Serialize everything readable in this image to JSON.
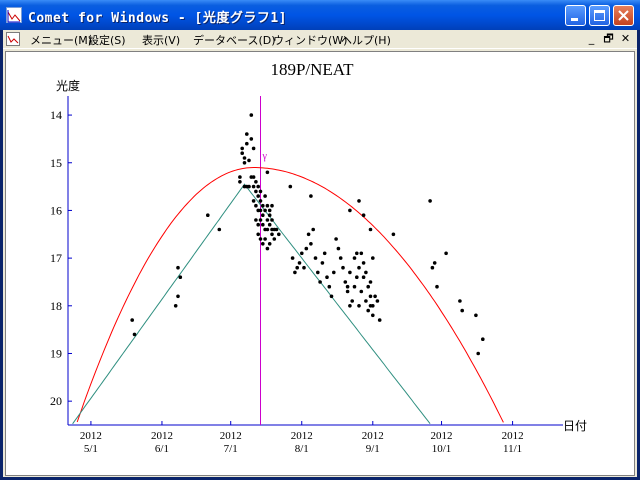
{
  "window": {
    "title": "Comet for Windows - [光度グラフ1]"
  },
  "menu": {
    "items": [
      "メニュー(M)",
      "設定(S)",
      "表示(V)",
      "データベース(D)",
      "ウィンドウ(W)",
      "ヘルプ(H)"
    ]
  },
  "mdi_controls": [
    "_",
    "🗗",
    "✕"
  ],
  "chart_data": {
    "type": "scatter",
    "title": "189P/NEAT",
    "ylabel": "光度",
    "xlabel": "日付",
    "x_ticks": [
      {
        "year": "2012",
        "label": "5/1"
      },
      {
        "year": "2012",
        "label": "6/1"
      },
      {
        "year": "2012",
        "label": "7/1"
      },
      {
        "year": "2012",
        "label": "8/1"
      },
      {
        "year": "2012",
        "label": "9/1"
      },
      {
        "year": "2012",
        "label": "10/1"
      },
      {
        "year": "2012",
        "label": "11/1"
      }
    ],
    "y_ticks": [
      "14",
      "15",
      "16",
      "17",
      "18",
      "19",
      "20"
    ],
    "ylim": [
      13.6,
      20.5
    ],
    "y_inverted": true,
    "xlim_days_from_may1": [
      -10,
      206
    ],
    "colors": {
      "points": "#000000",
      "red_curve": "#FF0000",
      "teal_curve": "#2F8F80",
      "marker_line": "#CC00CC",
      "axis": "#0000CC"
    },
    "marker_line": {
      "x": "2012-07-14",
      "label": "γ"
    },
    "red_curve": {
      "peak_x": "2012-07-11",
      "peak_mag": 15.1
    },
    "teal_curve": {
      "peak_x": "2012-07-07",
      "peak_mag": 15.45
    },
    "points": [
      [
        "05-19",
        18.3
      ],
      [
        "05-20",
        18.6
      ],
      [
        "06-08",
        17.2
      ],
      [
        "06-09",
        17.4
      ],
      [
        "06-07",
        18.0
      ],
      [
        "06-08",
        17.8
      ],
      [
        "06-21",
        16.1
      ],
      [
        "06-26",
        16.4
      ],
      [
        "07-05",
        15.3
      ],
      [
        "07-05",
        15.4
      ],
      [
        "07-06",
        14.7
      ],
      [
        "07-06",
        14.8
      ],
      [
        "07-07",
        14.9
      ],
      [
        "07-07",
        15.0
      ],
      [
        "07-08",
        14.4
      ],
      [
        "07-08",
        14.6
      ],
      [
        "07-09",
        14.95
      ],
      [
        "07-10",
        14.0
      ],
      [
        "07-10",
        14.5
      ],
      [
        "07-11",
        14.7
      ],
      [
        "07-07",
        15.5
      ],
      [
        "07-08",
        15.5
      ],
      [
        "07-09",
        15.5
      ],
      [
        "07-10",
        15.3
      ],
      [
        "07-11",
        15.3
      ],
      [
        "07-11",
        15.5
      ],
      [
        "07-12",
        15.6
      ],
      [
        "07-12",
        15.4
      ],
      [
        "07-13",
        15.7
      ],
      [
        "07-13",
        15.5
      ],
      [
        "07-14",
        15.6
      ],
      [
        "07-14",
        15.8
      ],
      [
        "07-11",
        15.8
      ],
      [
        "07-12",
        15.9
      ],
      [
        "07-13",
        16.0
      ],
      [
        "07-14",
        16.0
      ],
      [
        "07-15",
        15.9
      ],
      [
        "07-15",
        16.1
      ],
      [
        "07-16",
        15.7
      ],
      [
        "07-16",
        16.0
      ],
      [
        "07-17",
        15.9
      ],
      [
        "07-17",
        16.2
      ],
      [
        "07-18",
        16.0
      ],
      [
        "07-18",
        16.1
      ],
      [
        "07-19",
        15.9
      ],
      [
        "07-19",
        16.2
      ],
      [
        "07-12",
        16.2
      ],
      [
        "07-13",
        16.3
      ],
      [
        "07-14",
        16.2
      ],
      [
        "07-15",
        16.3
      ],
      [
        "07-16",
        16.4
      ],
      [
        "07-17",
        16.4
      ],
      [
        "07-18",
        16.3
      ],
      [
        "07-19",
        16.4
      ],
      [
        "07-13",
        16.5
      ],
      [
        "07-14",
        16.6
      ],
      [
        "07-15",
        16.7
      ],
      [
        "07-16",
        16.6
      ],
      [
        "07-17",
        16.8
      ],
      [
        "07-18",
        16.7
      ],
      [
        "07-19",
        16.5
      ],
      [
        "07-20",
        16.4
      ],
      [
        "07-20",
        16.6
      ],
      [
        "07-21",
        16.4
      ],
      [
        "07-22",
        16.5
      ],
      [
        "07-17",
        15.2
      ],
      [
        "07-27",
        15.5
      ],
      [
        "07-28",
        17.0
      ],
      [
        "07-29",
        17.3
      ],
      [
        "07-30",
        17.2
      ],
      [
        "07-31",
        17.1
      ],
      [
        "08-01",
        16.9
      ],
      [
        "08-02",
        17.2
      ],
      [
        "08-03",
        16.8
      ],
      [
        "08-04",
        16.5
      ],
      [
        "08-05",
        15.7
      ],
      [
        "08-05",
        16.7
      ],
      [
        "08-06",
        16.4
      ],
      [
        "08-07",
        17.0
      ],
      [
        "08-08",
        17.3
      ],
      [
        "08-09",
        17.5
      ],
      [
        "08-10",
        17.1
      ],
      [
        "08-11",
        16.9
      ],
      [
        "08-12",
        17.4
      ],
      [
        "08-13",
        17.6
      ],
      [
        "08-14",
        17.8
      ],
      [
        "08-15",
        17.3
      ],
      [
        "08-16",
        16.6
      ],
      [
        "08-17",
        16.8
      ],
      [
        "08-18",
        17.0
      ],
      [
        "08-19",
        17.2
      ],
      [
        "08-20",
        17.5
      ],
      [
        "08-21",
        17.7
      ],
      [
        "08-22",
        18.0
      ],
      [
        "08-23",
        17.9
      ],
      [
        "08-24",
        17.6
      ],
      [
        "08-25",
        17.4
      ],
      [
        "08-26",
        17.2
      ],
      [
        "08-27",
        16.9
      ],
      [
        "08-28",
        17.1
      ],
      [
        "08-29",
        17.3
      ],
      [
        "08-30",
        17.6
      ],
      [
        "08-31",
        17.8
      ],
      [
        "09-01",
        18.0
      ],
      [
        "08-31",
        17.5
      ],
      [
        "09-01",
        18.2
      ],
      [
        "09-02",
        17.8
      ],
      [
        "09-03",
        17.9
      ],
      [
        "08-26",
        18.0
      ],
      [
        "08-27",
        17.7
      ],
      [
        "08-28",
        17.4
      ],
      [
        "08-29",
        17.9
      ],
      [
        "08-30",
        18.1
      ],
      [
        "08-31",
        18.0
      ],
      [
        "08-21",
        17.6
      ],
      [
        "08-22",
        17.3
      ],
      [
        "08-24",
        17.0
      ],
      [
        "08-25",
        16.9
      ],
      [
        "08-22",
        16.0
      ],
      [
        "08-26",
        15.8
      ],
      [
        "08-28",
        16.1
      ],
      [
        "08-31",
        16.4
      ],
      [
        "09-01",
        17.0
      ],
      [
        "09-04",
        18.3
      ],
      [
        "09-10",
        16.5
      ],
      [
        "09-26",
        15.8
      ],
      [
        "09-27",
        17.2
      ],
      [
        "09-28",
        17.1
      ],
      [
        "09-29",
        17.6
      ],
      [
        "10-03",
        16.9
      ],
      [
        "10-09",
        17.9
      ],
      [
        "10-10",
        18.1
      ],
      [
        "10-16",
        18.2
      ],
      [
        "10-17",
        19.0
      ],
      [
        "10-19",
        18.7
      ]
    ]
  }
}
